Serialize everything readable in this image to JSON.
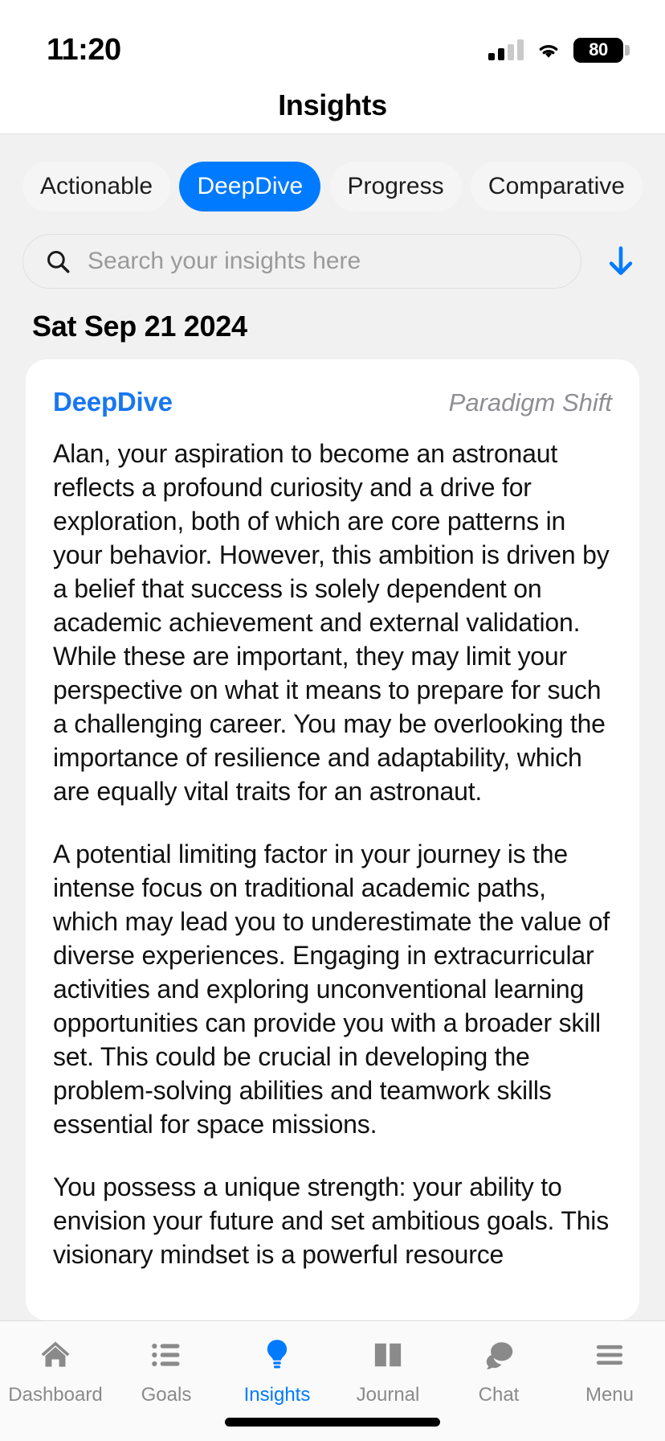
{
  "status_bar": {
    "time": "11:20",
    "battery_level": "80",
    "icons": [
      "cellular-signal-icon",
      "wifi-icon",
      "battery-icon"
    ]
  },
  "header": {
    "title": "Insights"
  },
  "filter_tabs": {
    "items": [
      {
        "label": "Actionable",
        "active": false
      },
      {
        "label": "DeepDive",
        "active": true
      },
      {
        "label": "Progress",
        "active": false
      },
      {
        "label": "Comparative",
        "active": false
      }
    ],
    "active_color": "#007aff"
  },
  "search": {
    "placeholder": "Search your insights here",
    "value": "",
    "icon": "search-icon",
    "sort_icon": "arrow-down-icon",
    "sort_icon_color": "#007aff"
  },
  "date_header": "Sat Sep 21 2024",
  "insight_card": {
    "kind": "DeepDive",
    "kind_color": "#1877f2",
    "tag": "Paradigm Shift",
    "paragraphs": [
      "Alan, your aspiration to become an astronaut reflects a profound curiosity and a drive for exploration, both of which are core patterns in your behavior. However, this ambition is driven by a belief that success is solely dependent on academic achievement and external validation. While these are important, they may limit your perspective on what it means to prepare for such a challenging career. You may be overlooking the importance of resilience and adaptability, which are equally vital traits for an astronaut.",
      "A potential limiting factor in your journey is the intense focus on traditional academic paths, which may lead you to underestimate the value of diverse experiences. Engaging in extracurricular activities and exploring unconventional learning opportunities can provide you with a broader skill set. This could be crucial in developing the problem-solving abilities and teamwork skills essential for space missions.",
      "You possess a unique strength: your ability to envision your future and set ambitious goals. This visionary mindset is a powerful resource"
    ]
  },
  "bottom_nav": {
    "active_color": "#007aff",
    "items": [
      {
        "label": "Dashboard",
        "icon": "home-icon",
        "active": false
      },
      {
        "label": "Goals",
        "icon": "list-icon",
        "active": false
      },
      {
        "label": "Insights",
        "icon": "lightbulb-icon",
        "active": true
      },
      {
        "label": "Journal",
        "icon": "book-icon",
        "active": false
      },
      {
        "label": "Chat",
        "icon": "chat-bubbles-icon",
        "active": false
      },
      {
        "label": "Menu",
        "icon": "hamburger-menu-icon",
        "active": false
      }
    ]
  }
}
